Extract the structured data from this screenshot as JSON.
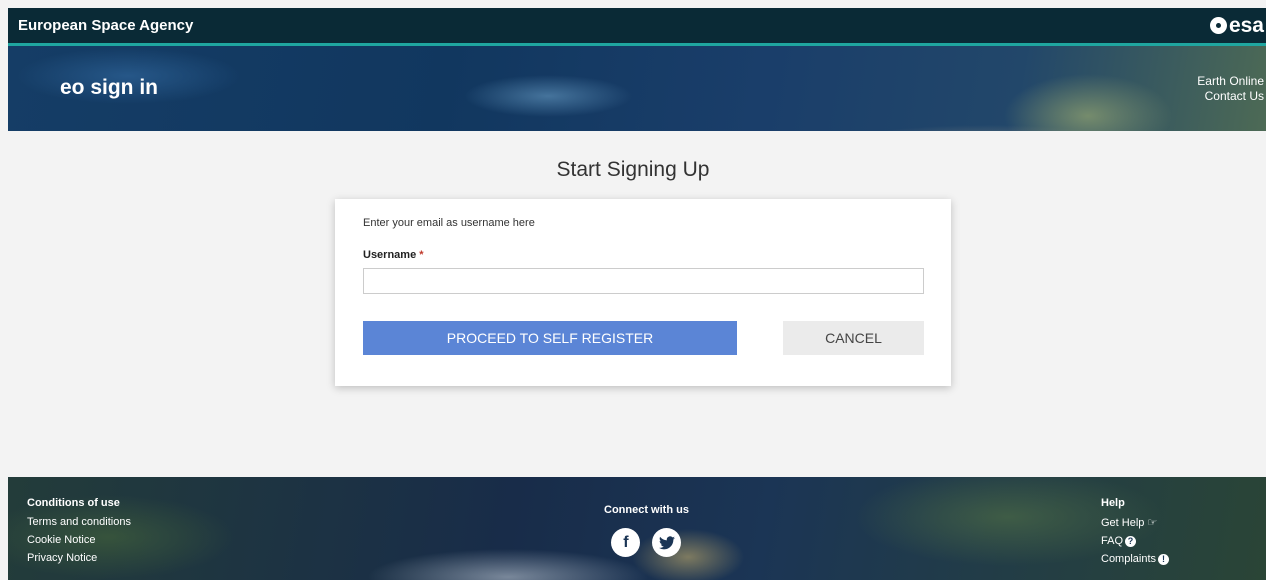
{
  "topbar": {
    "agency": "European Space Agency",
    "logo_text": "esa"
  },
  "banner": {
    "title": "eo sign in",
    "links": [
      "Earth Online",
      "Contact Us"
    ]
  },
  "page": {
    "title": "Start Signing Up"
  },
  "form": {
    "hint": "Enter your email as username here",
    "username_label": "Username",
    "required_mark": "*",
    "username_value": "",
    "proceed_label": "PROCEED TO SELF REGISTER",
    "cancel_label": "CANCEL"
  },
  "footer": {
    "conditions_head": "Conditions of use",
    "conditions_links": [
      "Terms and conditions",
      "Cookie Notice",
      "Privacy Notice"
    ],
    "connect_head": "Connect with us",
    "social_icons": [
      "facebook-icon",
      "twitter-icon"
    ],
    "help_head": "Help",
    "help_links": [
      "Get Help",
      "FAQ",
      "Complaints"
    ]
  },
  "colors": {
    "accent": "#5b85d6",
    "topbar": "#0a2a36",
    "teal": "#1fa6a0"
  }
}
